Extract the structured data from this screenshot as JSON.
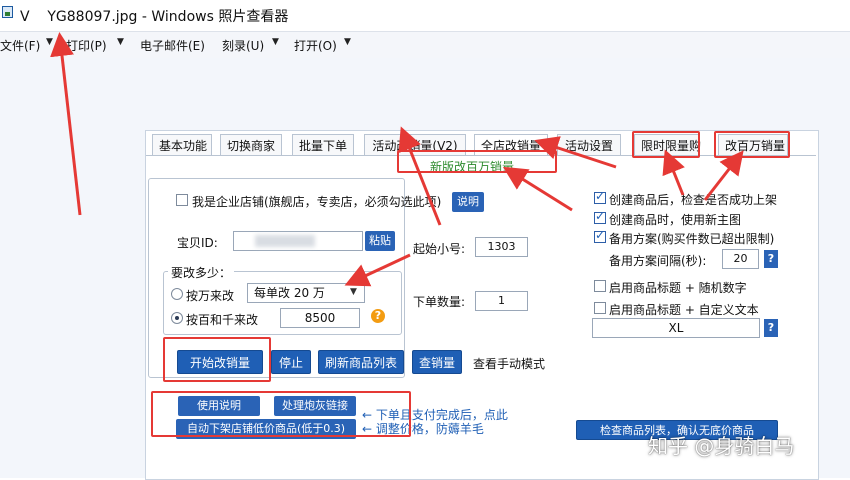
{
  "window": {
    "title": "V    YG88097.jpg - Windows 照片查看器"
  },
  "menu": {
    "items": [
      {
        "label": "文件(F)"
      },
      {
        "label": "打印(P)"
      },
      {
        "label": "电子邮件(E)"
      },
      {
        "label": "刻录(U)"
      },
      {
        "label": "打开(O)"
      }
    ]
  },
  "tool": {
    "tabs": [
      {
        "label": "基本功能"
      },
      {
        "label": "切换商家"
      },
      {
        "label": "批量下单"
      },
      {
        "label": "活动改销量(V2)"
      },
      {
        "label": "全店改销量"
      },
      {
        "label": "活动设置"
      },
      {
        "label": "限时限量购"
      },
      {
        "label": "改百万销量"
      }
    ],
    "banner": "新版改百万销量",
    "enterprise_label": "我是企业店铺(旗舰店，专卖店，必须勾选此项)",
    "explain_button": "说明",
    "item_id_label": "宝贝ID:",
    "item_id_value": "",
    "paste_button": "粘贴",
    "start_no_label": "起始小号:",
    "start_no_value": "1303",
    "order_qty_label": "下单数量:",
    "order_qty_value": "1",
    "change_amount_group": "要改多少：",
    "by_wan_label": "按万来改",
    "per_order_select": "每单改 20 万",
    "by_baiqian_label": "按百和千来改",
    "baiqian_value": "8500",
    "help_glyph": "?",
    "buttons": {
      "start": "开始改销量",
      "stop": "停止",
      "refresh": "刷新商品列表",
      "check_sales": "查销量",
      "manual_mode": "查看手动模式",
      "manual": "使用说明",
      "cannon_links": "处理炮灰链接",
      "auto_delist": "自动下架店铺低价商品(低于0.3)",
      "check_list": "检查商品列表，确认无底价商品"
    },
    "notes": {
      "after_pay": "← 下单且支付完成后，点此",
      "adjust_price": "← 调整价格，防薅羊毛"
    },
    "options": [
      {
        "label": "创建商品后，检查是否成功上架",
        "checked": true
      },
      {
        "label": "创建商品时，使用新主图",
        "checked": true
      },
      {
        "label": "备用方案(购买件数已超出限制)",
        "checked": true
      }
    ],
    "interval_label": "备用方案间隔(秒):",
    "interval_value": "20",
    "title_random_label": "启用商品标题 + 随机数字",
    "title_custom_label": "启用商品标题 + 自定义文本",
    "custom_text_value": "XL",
    "q_glyph": "?"
  },
  "watermark": "知乎 @身骑白马",
  "colors": {
    "button_blue": "#1f5fb5",
    "annotation_red": "#e53935",
    "banner_green": "#2e8b2e"
  }
}
